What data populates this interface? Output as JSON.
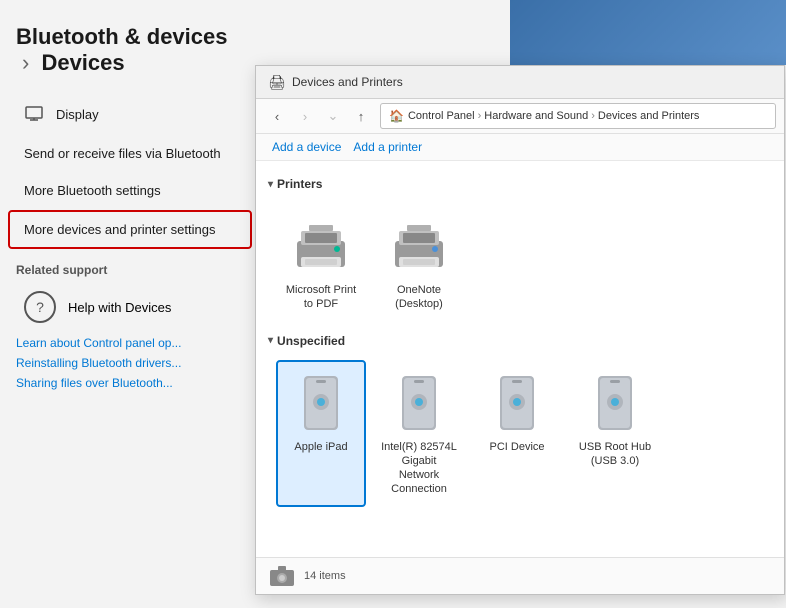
{
  "page": {
    "title_prefix": "Bluetooth & devices",
    "title_separator": "›",
    "title_main": "Devices"
  },
  "nav": {
    "display_label": "Display"
  },
  "sidebar": {
    "send_receive_label": "Send or receive files via Bluetooth",
    "more_bluetooth_label": "More Bluetooth settings",
    "more_devices_label": "More devices and printer settings",
    "related_support": "Related support",
    "help_devices_label": "Help with Devices",
    "links": [
      "Learn about Control panel op...",
      "Reinstalling Bluetooth drivers...",
      "Sharing files over Bluetooth..."
    ]
  },
  "window": {
    "title": "Devices and Printers",
    "breadcrumb": {
      "root": "Control Panel",
      "level1": "Hardware and Sound",
      "level2": "Devices and Printers"
    },
    "toolbar": {
      "add_device": "Add a device",
      "add_printer": "Add a printer"
    },
    "sections": {
      "printers": {
        "label": "Printers",
        "items": [
          {
            "name": "Microsoft Print\nto PDF",
            "type": "printer",
            "color": "teal"
          },
          {
            "name": "OneNote\n(Desktop)",
            "type": "printer",
            "color": "blue"
          }
        ]
      },
      "unspecified": {
        "label": "Unspecified",
        "items": [
          {
            "name": "Apple iPad",
            "type": "tower",
            "selected": true
          },
          {
            "name": "Intel(R) 82574L\nGigabit Network\nConnection",
            "type": "tower",
            "selected": false
          },
          {
            "name": "PCI Device",
            "type": "tower",
            "selected": false
          },
          {
            "name": "USB Root Hub\n(USB 3.0)",
            "type": "tower",
            "selected": false
          }
        ]
      }
    },
    "status_bar": {
      "count": "14 items"
    }
  },
  "icons": {
    "display": "🖥",
    "bluetooth": "⟳",
    "help": "?",
    "back": "‹",
    "forward": "›",
    "up": "↑",
    "expand": "v",
    "chevron_down": "▾",
    "globe": "🌐"
  }
}
